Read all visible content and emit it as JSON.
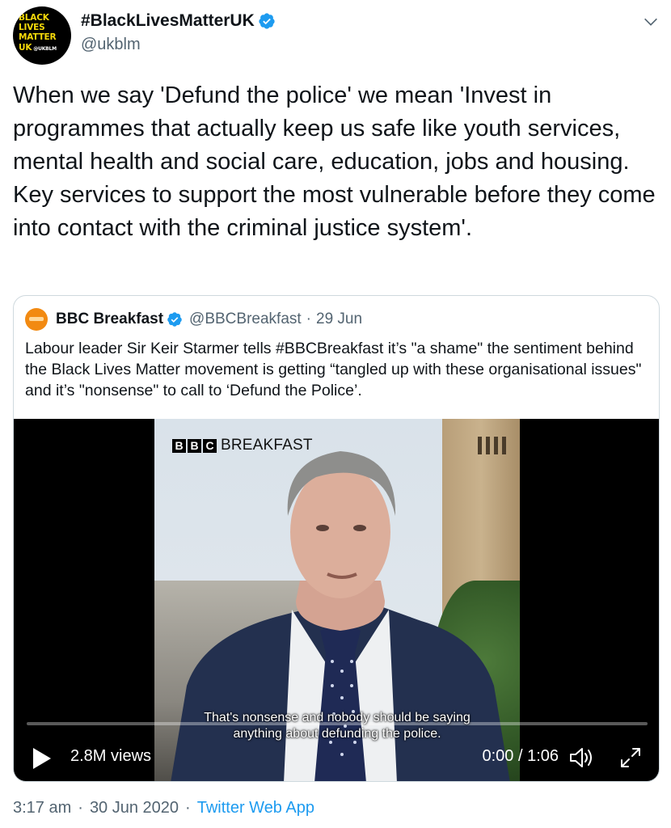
{
  "author": {
    "display_name": "#BlackLivesMatterUK",
    "handle": "@ukblm",
    "verified": true,
    "avatar_text": [
      "BLACK",
      "LIVES",
      "MATTER",
      "UK",
      "@UKBLM"
    ]
  },
  "tweet": {
    "text": "When we say 'Defund the police' we mean 'Invest in programmes that actually keep us safe like youth services, mental health and social care, education, jobs and housing. Key services to support the most vulnerable before they come into contact with the criminal justice system'."
  },
  "quote": {
    "display_name": "BBC Breakfast",
    "handle": "@BBCBreakfast",
    "separator": "·",
    "date": "29 Jun",
    "text": "Labour leader Sir Keir Starmer tells #BBCBreakfast it’s \"a shame\" the sentiment behind the Black Lives Matter movement is getting “tangled up with these organisational issues\" and it’s \"nonsense\" to call to ‘Defund the Police’."
  },
  "video": {
    "logo_letters": [
      "B",
      "B",
      "C"
    ],
    "logo_word": "BREAKFAST",
    "subtitle_line1": "That's nonsense and nobody should be saying",
    "subtitle_line2": "anything about defunding the police.",
    "views": "2.8M views",
    "time": "0:00 / 1:06",
    "progress": 0
  },
  "meta": {
    "time": "3:17 am",
    "separator": "·",
    "date": "30 Jun 2020",
    "source": "Twitter Web App"
  },
  "icons": {
    "verified": "verified-badge-icon",
    "caret": "chevron-down-icon",
    "play": "play-icon",
    "volume": "volume-icon",
    "expand": "expand-icon"
  },
  "colors": {
    "accent": "#1d9bf0",
    "muted": "#536471",
    "avatar_text": "#f5d90a",
    "bbc_avatar": "#f28a12"
  }
}
